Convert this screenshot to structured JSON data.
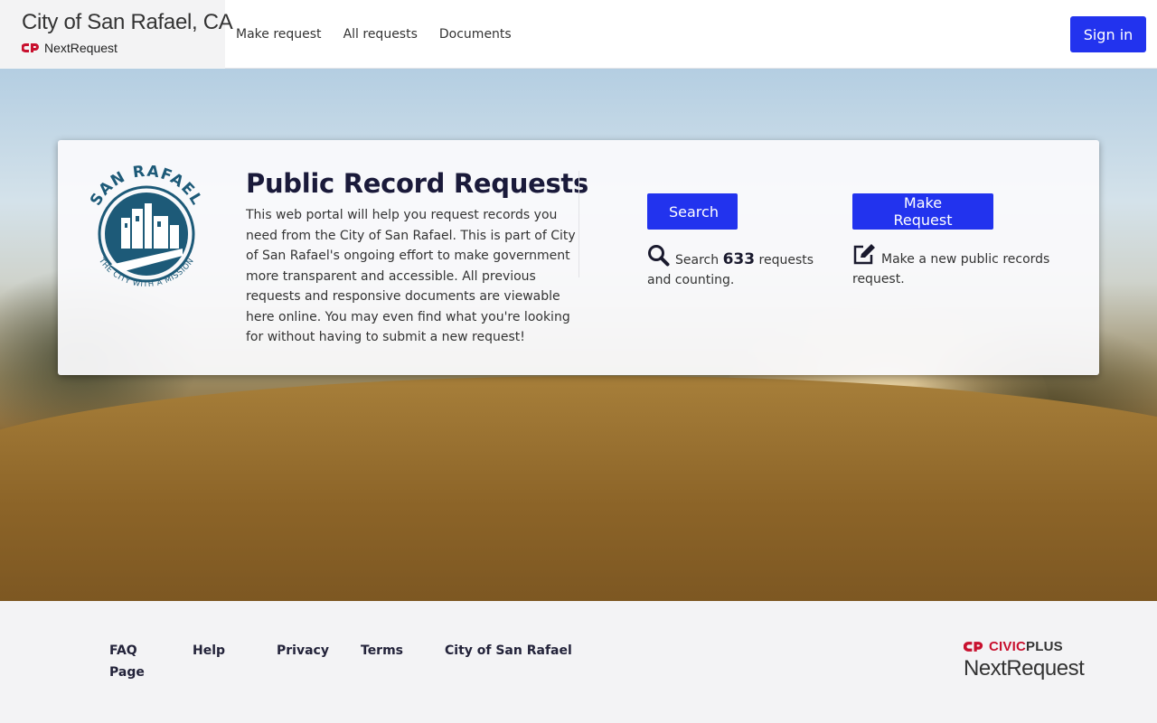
{
  "header": {
    "site_title": "City of San Rafael, CA",
    "product_name": "NextRequest",
    "nav": [
      {
        "label": "Make request"
      },
      {
        "label": "All requests"
      },
      {
        "label": "Documents"
      }
    ],
    "sign_in_label": "Sign in"
  },
  "hero": {
    "seal": {
      "top_text": "SAN RAFAEL",
      "bottom_text": "THE CITY WITH A MISSION"
    },
    "title": "Public Record Requests",
    "description": "This web portal will help you request records you need from the City of San Rafael. This is part of City of San Rafael's ongoing effort to make government more transparent and accessible. All previous requests and responsive documents are viewable here online. You may even find what you're looking for without having to submit a new request!",
    "search": {
      "button_label": "Search",
      "desc_prefix": "Search",
      "count": "633",
      "desc_suffix": "requests and counting.",
      "icon": "magnifier-icon"
    },
    "make_request": {
      "button_label": "Make Request",
      "desc": "Make a new public records request.",
      "icon": "edit-icon"
    }
  },
  "footer": {
    "links": [
      {
        "label": "FAQ Page"
      },
      {
        "label": "Help"
      },
      {
        "label": "Privacy"
      },
      {
        "label": "Terms"
      },
      {
        "label": "City of San Rafael"
      }
    ],
    "logo_civic": "CIVIC",
    "logo_plus": "PLUS",
    "logo_product": "NextRequest"
  },
  "colors": {
    "primary_button": "#2233ee",
    "brand_red": "#c8102e",
    "seal_teal": "#1d5a78"
  }
}
